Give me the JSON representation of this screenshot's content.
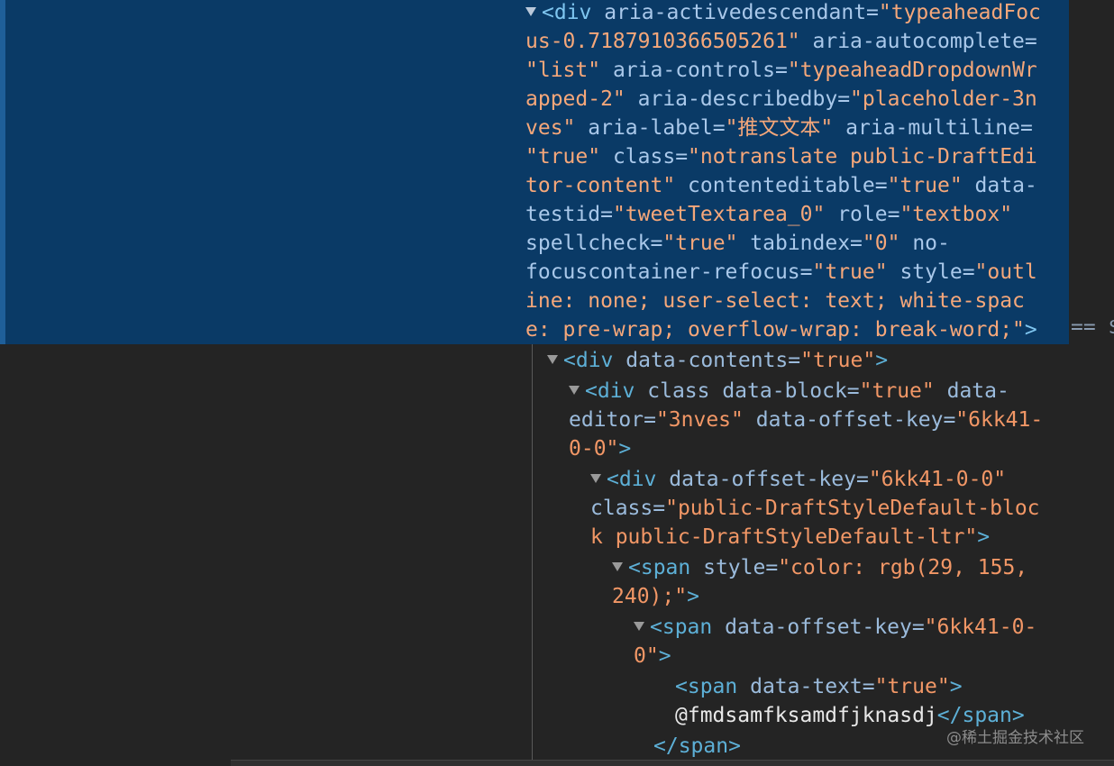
{
  "colors": {
    "background": "#242424",
    "selection": "#0a3a66",
    "tag": "#5db0d7",
    "attribute_name": "#9bbbdc",
    "attribute_value": "#f29766",
    "text": "#e8e8e8"
  },
  "selected_node": {
    "l1": {
      "tag": "<div",
      "n1": "aria-activedescendant=",
      "v1": "\"typeaheadFoc"
    },
    "l2": {
      "v1": "us-0.7187910366505261\"",
      "n1": "aria-autocomplete="
    },
    "l3": {
      "v1": "\"list\"",
      "n1": "aria-controls=",
      "v2": "\"typeaheadDropdownWr"
    },
    "l4": {
      "v1": "apped-2\"",
      "n1": "aria-describedby=",
      "v2": "\"placeholder-3n"
    },
    "l5": {
      "v1": "ves\"",
      "n1": "aria-label=",
      "v2": "\"推文文本\"",
      "n2": "aria-multiline="
    },
    "l6": {
      "v1": "\"true\"",
      "n1": "class=",
      "v2": "\"notranslate public-DraftEdi"
    },
    "l7": {
      "v1": "tor-content\"",
      "n1": "contenteditable=",
      "v2": "\"true\"",
      "n2": "data-"
    },
    "l8": {
      "n1": "testid=",
      "v1": "\"tweetTextarea_0\"",
      "n2": "role=",
      "v2": "\"textbox\""
    },
    "l9": {
      "n1": "spellcheck=",
      "v1": "\"true\"",
      "n2": "tabindex=",
      "v2": "\"0\"",
      "n3": "no-"
    },
    "l10": {
      "n1": "focuscontainer-refocus=",
      "v1": "\"true\"",
      "n2": "style=",
      "v2": "\"outl"
    },
    "l11": {
      "v1": "ine: none; user-select: text; white-spac"
    },
    "l12": {
      "v1": "e: pre-wrap; overflow-wrap: break-word;\"",
      "close": ">"
    },
    "eq_marker": "== $"
  },
  "tree": {
    "r1": {
      "tag": "<div",
      "n1": "data-contents=",
      "v1": "\"true\"",
      "close": ">"
    },
    "r2": {
      "tag": "<div",
      "n1": "class data-block=",
      "v1": "\"true\"",
      "n2": "data-"
    },
    "r3": {
      "n1": "editor=",
      "v1": "\"3nves\"",
      "n2": "data-offset-key=",
      "v2": "\"6kk41-"
    },
    "r4": {
      "v1": "0-0\"",
      "close": ">"
    },
    "r5": {
      "tag": "<div",
      "n1": "data-offset-key=",
      "v1": "\"6kk41-0-0\""
    },
    "r6": {
      "n1": "class=",
      "v1": "\"public-DraftStyleDefault-bloc"
    },
    "r7": {
      "v1": "k public-DraftStyleDefault-ltr\"",
      "close": ">"
    },
    "r8": {
      "tag": "<span",
      "n1": "style=",
      "v1": "\"color: rgb(29, 155,"
    },
    "r9": {
      "v1": "240);\"",
      "close": ">"
    },
    "r10": {
      "tag": "<span",
      "n1": "data-offset-key=",
      "v1": "\"6kk41-0-"
    },
    "r11": {
      "v1": "0\"",
      "close": ">"
    },
    "r12": {
      "tag": "<span",
      "n1": "data-text=",
      "v1": "\"true\"",
      "close": ">"
    },
    "r13": {
      "text": "@fmdsamfksamdfjknasdj",
      "close": "</span>"
    },
    "r14": {
      "close": "</span>"
    }
  },
  "watermark": "@稀土掘金技术社区"
}
